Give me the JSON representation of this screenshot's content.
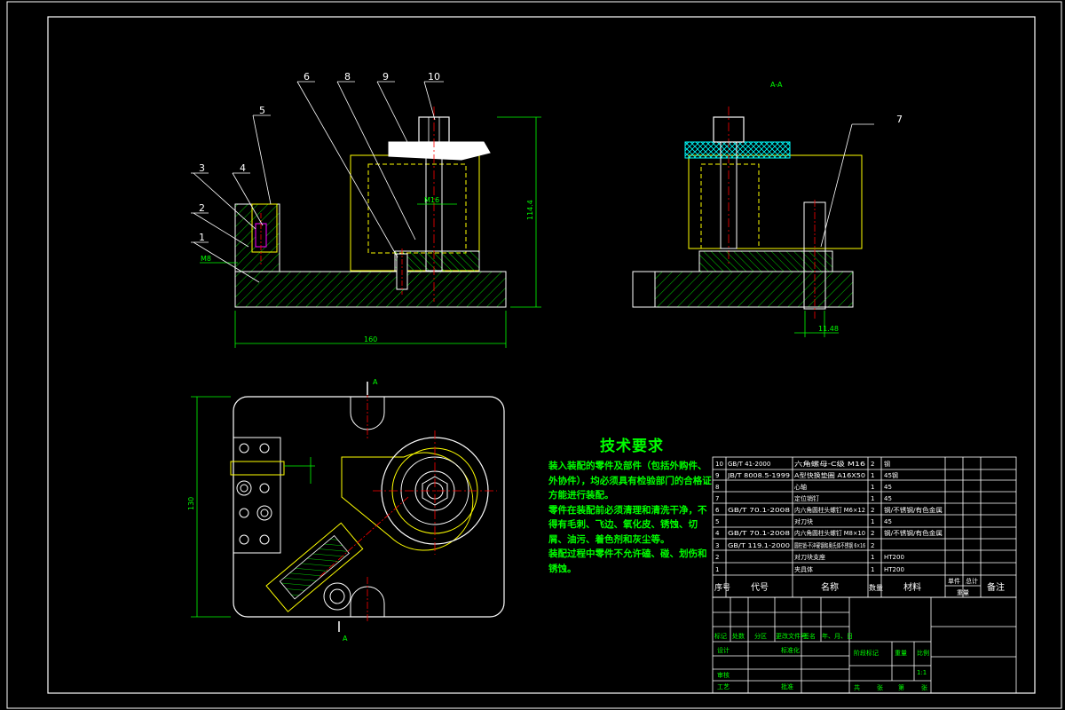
{
  "colors": {
    "background": "#000000",
    "border": "#ffffff",
    "text": "#ffffff",
    "hatch": "#00ff00",
    "part_outline": "#ffff00",
    "dimension": "#00ff00",
    "centerline": "#ff0000",
    "handle": "#00ffff"
  },
  "balloons": {
    "b1": "1",
    "b2": "2",
    "b3": "3",
    "b4": "4",
    "b5": "5",
    "b6": "6",
    "b7": "7",
    "b8": "8",
    "b9": "9",
    "b10": "10"
  },
  "dimensions": {
    "overall_length": "160",
    "overall_height": "114.4",
    "plan_width": "130",
    "side_offset": "11.48",
    "bolt_label": "M16",
    "small_label": "M8"
  },
  "section_marks": {
    "section_title": "A-A",
    "cut_top": "A",
    "cut_bottom": "A"
  },
  "technical_requirements": {
    "title": "技术要求",
    "lines": [
      "装入装配的零件及部件（包括外购件、外协件），均必须具有检验部门的合格证方能进行装配。",
      "零件在装配前必须清理和清洗干净，不得有毛刺、飞边、氧化皮、锈蚀、切屑、油污、着色剂和灰尘等。",
      "装配过程中零件不允许磕、碰、划伤和锈蚀。"
    ]
  },
  "parts_list": {
    "header": {
      "seq": "序号",
      "code": "代号",
      "name": "名称",
      "qty": "数量",
      "material": "材料",
      "unit": "单件",
      "total": "总计",
      "weight": "重量",
      "remark": "备注"
    },
    "rows": [
      {
        "seq": "10",
        "code": "GB/T 41-2000",
        "name": "六角螺母-C级 M16",
        "qty": "2",
        "material": "钢"
      },
      {
        "seq": "9",
        "code": "JB/T 8008.5-1999",
        "name": "A型快换垫圈 A16X50",
        "qty": "1",
        "material": "45钢"
      },
      {
        "seq": "8",
        "code": "",
        "name": "心轴",
        "qty": "1",
        "material": "45"
      },
      {
        "seq": "7",
        "code": "",
        "name": "定位销钉",
        "qty": "1",
        "material": "45"
      },
      {
        "seq": "6",
        "code": "GB/T 70.1-2008",
        "name": "内六角圆柱头螺钉 M6×12",
        "qty": "2",
        "material": "钢/不锈钢/有色金属"
      },
      {
        "seq": "5",
        "code": "",
        "name": "对刀块",
        "qty": "1",
        "material": "45"
      },
      {
        "seq": "4",
        "code": "GB/T 70.1-2008",
        "name": "内六角圆柱头螺钉 M8×10",
        "qty": "2",
        "material": "钢/不锈钢/有色金属"
      },
      {
        "seq": "3",
        "code": "GB/T 119.1-2000",
        "name": "圆柱销-不淬硬钢和奥氏体不锈钢 6×16",
        "qty": "2",
        "material": ""
      },
      {
        "seq": "2",
        "code": "",
        "name": "对刀块支座",
        "qty": "1",
        "material": "HT200"
      },
      {
        "seq": "1",
        "code": "",
        "name": "夹具体",
        "qty": "1",
        "material": "HT200"
      }
    ]
  },
  "title_block": {
    "mark": "标记",
    "count": "处数",
    "zone": "分区",
    "change_doc": "更改文件号",
    "signature": "签名",
    "date": "年、月、日",
    "design": "设计",
    "standardize": "标准化",
    "stage_mark": "阶段标记",
    "weight": "重量",
    "scale": "比例",
    "scale_value": "1:1",
    "review": "审核",
    "process": "工艺",
    "approve": "批准",
    "sheets": "共",
    "zhang": "张",
    "di": "第",
    "zhang2": "张"
  }
}
